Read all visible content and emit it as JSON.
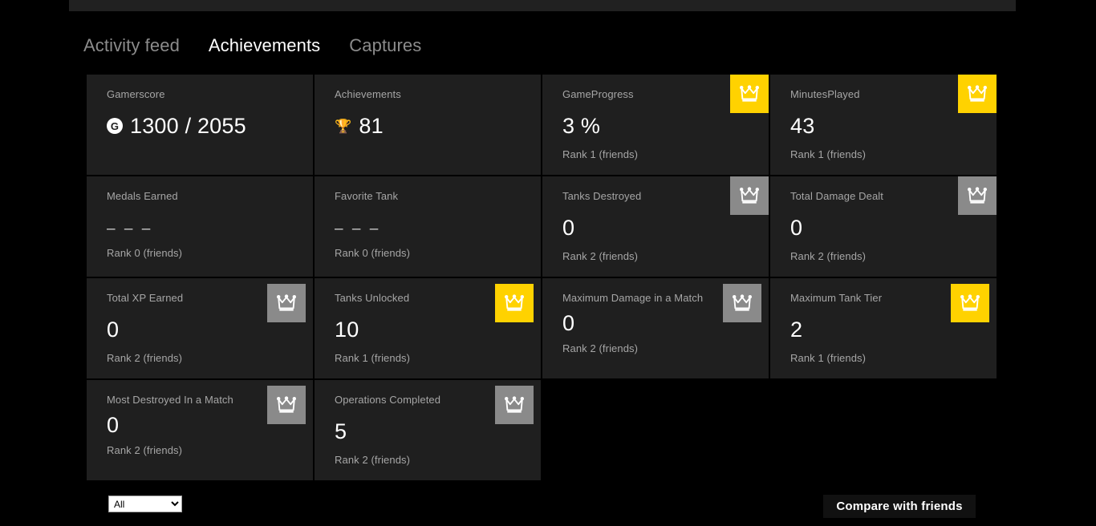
{
  "tabs": [
    {
      "label": "Activity feed",
      "active": false
    },
    {
      "label": "Achievements",
      "active": true
    },
    {
      "label": "Captures",
      "active": false
    }
  ],
  "stats": [
    {
      "label": "Gamerscore",
      "value": "1300 / 2055",
      "icon": "gamerscore-g-icon",
      "rank": "",
      "badge": "none"
    },
    {
      "label": "Achievements",
      "value": "81",
      "icon": "trophy-icon",
      "rank": "",
      "badge": "none"
    },
    {
      "label": "GameProgress",
      "value": "3 %",
      "icon": "",
      "rank": "Rank 1 (friends)",
      "badge": "gold"
    },
    {
      "label": "MinutesPlayed",
      "value": "43",
      "icon": "",
      "rank": "Rank 1 (friends)",
      "badge": "gold"
    },
    {
      "label": "Medals Earned",
      "value": "– – –",
      "icon": "",
      "rank": "Rank 0 (friends)",
      "badge": "none"
    },
    {
      "label": "Favorite Tank",
      "value": "– – –",
      "icon": "",
      "rank": "Rank 0 (friends)",
      "badge": "none"
    },
    {
      "label": "Tanks Destroyed",
      "value": "0",
      "icon": "",
      "rank": "Rank 2 (friends)",
      "badge": "silver"
    },
    {
      "label": "Total Damage Dealt",
      "value": "0",
      "icon": "",
      "rank": "Rank 2 (friends)",
      "badge": "silver"
    },
    {
      "label": "Total XP Earned",
      "value": "0",
      "icon": "",
      "rank": "Rank 2 (friends)",
      "badge": "silver"
    },
    {
      "label": "Tanks Unlocked",
      "value": "10",
      "icon": "",
      "rank": "Rank 1 (friends)",
      "badge": "gold"
    },
    {
      "label": "Maximum Damage in a Match",
      "value": "0",
      "icon": "",
      "rank": "Rank 2 (friends)",
      "badge": "silver"
    },
    {
      "label": "Maximum Tank Tier",
      "value": "2",
      "icon": "",
      "rank": "Rank 1 (friends)",
      "badge": "gold"
    },
    {
      "label": "Most Destroyed In a Match",
      "value": "0",
      "icon": "",
      "rank": "Rank 2 (friends)",
      "badge": "silver"
    },
    {
      "label": "Operations Completed",
      "value": "5",
      "icon": "",
      "rank": "Rank 2 (friends)",
      "badge": "silver"
    }
  ],
  "filter": {
    "selected": "All",
    "options": [
      "All"
    ]
  },
  "compare_button": {
    "label": "Compare with friends"
  },
  "colors": {
    "gold_badge": "#ffd200",
    "silver_badge": "#8a8a8a",
    "tile_background": "#1f1f1f",
    "page_background": "#000000",
    "muted_text": "#a6a6a6"
  }
}
